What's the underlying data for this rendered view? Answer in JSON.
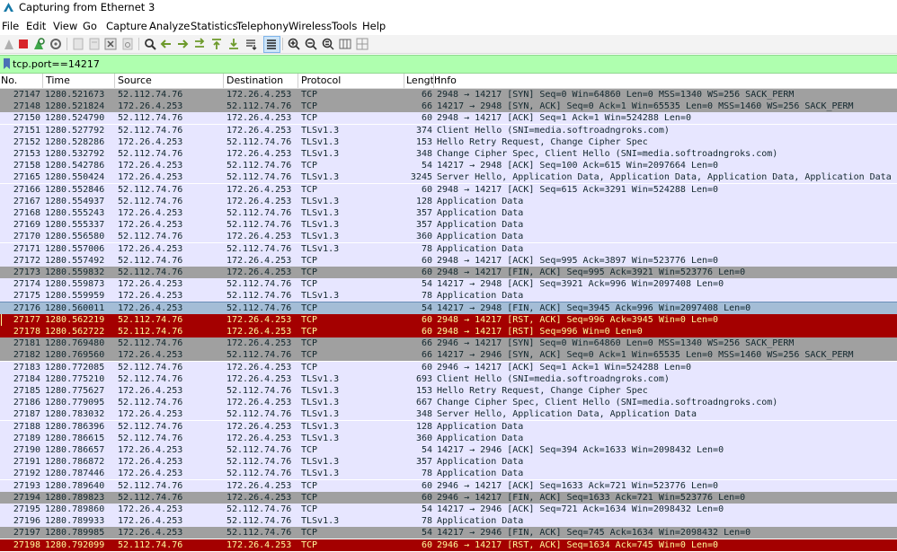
{
  "window": {
    "title": "Capturing from Ethernet 3"
  },
  "menu": [
    "File",
    "Edit",
    "View",
    "Go",
    "Capture",
    "Analyze",
    "Statistics",
    "Telephony",
    "Wireless",
    "Tools",
    "Help"
  ],
  "filter": {
    "value": "tcp.port==14217"
  },
  "columns": [
    "No.",
    "Time",
    "Source",
    "Destination",
    "Protocol",
    "Length",
    "Info"
  ],
  "colors": {
    "tcp_row": "#e7e6ff",
    "flag_row": "#a0a0a0",
    "selected_row": "#a4bdd6",
    "rst_row": "#a40000",
    "rst_text": "#fffc9c",
    "filter_ok": "#afffaf"
  },
  "toolbar_icons": [
    "shark-fin-start-icon",
    "stop-icon",
    "restart-icon",
    "options-gear-icon",
    "open-file-icon",
    "save-file-icon",
    "close-file-icon",
    "reload-icon",
    "find-icon",
    "back-arrow-icon",
    "forward-arrow-icon",
    "jump-icon",
    "first-packet-icon",
    "last-packet-icon",
    "autoscroll-icon",
    "colorize-icon",
    "zoom-in-icon",
    "zoom-out-icon",
    "normal-size-icon",
    "resize-columns-icon"
  ],
  "packets": [
    {
      "no": "27147",
      "time": "1280.521673",
      "src": "52.112.74.76",
      "dst": "172.26.4.253",
      "proto": "TCP",
      "len": "66",
      "info": "2948 → 14217 [SYN] Seq=0 Win=64860 Len=0 MSS=1340 WS=256 SACK_PERM",
      "style": "flag"
    },
    {
      "no": "27148",
      "time": "1280.521824",
      "src": "172.26.4.253",
      "dst": "52.112.74.76",
      "proto": "TCP",
      "len": "66",
      "info": "14217 → 2948 [SYN, ACK] Seq=0 Ack=1 Win=65535 Len=0 MSS=1460 WS=256 SACK_PERM",
      "style": "flag"
    },
    {
      "no": "27150",
      "time": "1280.524790",
      "src": "52.112.74.76",
      "dst": "172.26.4.253",
      "proto": "TCP",
      "len": "60",
      "info": "2948 → 14217 [ACK] Seq=1 Ack=1 Win=524288 Len=0",
      "style": "tcp"
    },
    {
      "no": "27151",
      "time": "1280.527792",
      "src": "52.112.74.76",
      "dst": "172.26.4.253",
      "proto": "TLSv1.3",
      "len": "374",
      "info": "Client Hello (SNI=media.softroadngroks.com)",
      "style": "tcp"
    },
    {
      "no": "27152",
      "time": "1280.528286",
      "src": "172.26.4.253",
      "dst": "52.112.74.76",
      "proto": "TLSv1.3",
      "len": "153",
      "info": "Hello Retry Request, Change Cipher Spec",
      "style": "tcp"
    },
    {
      "no": "27153",
      "time": "1280.532792",
      "src": "52.112.74.76",
      "dst": "172.26.4.253",
      "proto": "TLSv1.3",
      "len": "348",
      "info": "Change Cipher Spec, Client Hello (SNI=media.softroadngroks.com)",
      "style": "tcp"
    },
    {
      "no": "27158",
      "time": "1280.542786",
      "src": "172.26.4.253",
      "dst": "52.112.74.76",
      "proto": "TCP",
      "len": "54",
      "info": "14217 → 2948 [ACK] Seq=100 Ack=615 Win=2097664 Len=0",
      "style": "tcp"
    },
    {
      "no": "27165",
      "time": "1280.550424",
      "src": "172.26.4.253",
      "dst": "52.112.74.76",
      "proto": "TLSv1.3",
      "len": "3245",
      "info": "Server Hello, Application Data, Application Data, Application Data, Application Data",
      "style": "tcp"
    },
    {
      "no": "27166",
      "time": "1280.552846",
      "src": "52.112.74.76",
      "dst": "172.26.4.253",
      "proto": "TCP",
      "len": "60",
      "info": "2948 → 14217 [ACK] Seq=615 Ack=3291 Win=524288 Len=0",
      "style": "tcp"
    },
    {
      "no": "27167",
      "time": "1280.554937",
      "src": "52.112.74.76",
      "dst": "172.26.4.253",
      "proto": "TLSv1.3",
      "len": "128",
      "info": "Application Data",
      "style": "tcp"
    },
    {
      "no": "27168",
      "time": "1280.555243",
      "src": "172.26.4.253",
      "dst": "52.112.74.76",
      "proto": "TLSv1.3",
      "len": "357",
      "info": "Application Data",
      "style": "tcp"
    },
    {
      "no": "27169",
      "time": "1280.555337",
      "src": "172.26.4.253",
      "dst": "52.112.74.76",
      "proto": "TLSv1.3",
      "len": "357",
      "info": "Application Data",
      "style": "tcp"
    },
    {
      "no": "27170",
      "time": "1280.556580",
      "src": "52.112.74.76",
      "dst": "172.26.4.253",
      "proto": "TLSv1.3",
      "len": "360",
      "info": "Application Data",
      "style": "tcp"
    },
    {
      "no": "27171",
      "time": "1280.557006",
      "src": "172.26.4.253",
      "dst": "52.112.74.76",
      "proto": "TLSv1.3",
      "len": "78",
      "info": "Application Data",
      "style": "tcp"
    },
    {
      "no": "27172",
      "time": "1280.557492",
      "src": "52.112.74.76",
      "dst": "172.26.4.253",
      "proto": "TCP",
      "len": "60",
      "info": "2948 → 14217 [ACK] Seq=995 Ack=3897 Win=523776 Len=0",
      "style": "tcp"
    },
    {
      "no": "27173",
      "time": "1280.559832",
      "src": "52.112.74.76",
      "dst": "172.26.4.253",
      "proto": "TCP",
      "len": "60",
      "info": "2948 → 14217 [FIN, ACK] Seq=995 Ack=3921 Win=523776 Len=0",
      "style": "flag"
    },
    {
      "no": "27174",
      "time": "1280.559873",
      "src": "172.26.4.253",
      "dst": "52.112.74.76",
      "proto": "TCP",
      "len": "54",
      "info": "14217 → 2948 [ACK] Seq=3921 Ack=996 Win=2097408 Len=0",
      "style": "tcp"
    },
    {
      "no": "27175",
      "time": "1280.559959",
      "src": "172.26.4.253",
      "dst": "52.112.74.76",
      "proto": "TLSv1.3",
      "len": "78",
      "info": "Application Data",
      "style": "tcp"
    },
    {
      "no": "27176",
      "time": "1280.560011",
      "src": "172.26.4.253",
      "dst": "52.112.74.76",
      "proto": "TCP",
      "len": "54",
      "info": "14217 → 2948 [FIN, ACK] Seq=3945 Ack=996 Win=2097408 Len=0",
      "style": "selected"
    },
    {
      "no": "27177",
      "time": "1280.562219",
      "src": "52.112.74.76",
      "dst": "172.26.4.253",
      "proto": "TCP",
      "len": "60",
      "info": "2948 → 14217 [RST, ACK] Seq=996 Ack=3945 Win=0 Len=0",
      "style": "rst"
    },
    {
      "no": "27178",
      "time": "1280.562722",
      "src": "52.112.74.76",
      "dst": "172.26.4.253",
      "proto": "TCP",
      "len": "60",
      "info": "2948 → 14217 [RST] Seq=996 Win=0 Len=0",
      "style": "rst"
    },
    {
      "no": "27181",
      "time": "1280.769480",
      "src": "52.112.74.76",
      "dst": "172.26.4.253",
      "proto": "TCP",
      "len": "66",
      "info": "2946 → 14217 [SYN] Seq=0 Win=64860 Len=0 MSS=1340 WS=256 SACK_PERM",
      "style": "flag"
    },
    {
      "no": "27182",
      "time": "1280.769560",
      "src": "172.26.4.253",
      "dst": "52.112.74.76",
      "proto": "TCP",
      "len": "66",
      "info": "14217 → 2946 [SYN, ACK] Seq=0 Ack=1 Win=65535 Len=0 MSS=1460 WS=256 SACK_PERM",
      "style": "flag"
    },
    {
      "no": "27183",
      "time": "1280.772085",
      "src": "52.112.74.76",
      "dst": "172.26.4.253",
      "proto": "TCP",
      "len": "60",
      "info": "2946 → 14217 [ACK] Seq=1 Ack=1 Win=524288 Len=0",
      "style": "tcp"
    },
    {
      "no": "27184",
      "time": "1280.775210",
      "src": "52.112.74.76",
      "dst": "172.26.4.253",
      "proto": "TLSv1.3",
      "len": "693",
      "info": "Client Hello (SNI=media.softroadngroks.com)",
      "style": "tcp"
    },
    {
      "no": "27185",
      "time": "1280.775627",
      "src": "172.26.4.253",
      "dst": "52.112.74.76",
      "proto": "TLSv1.3",
      "len": "153",
      "info": "Hello Retry Request, Change Cipher Spec",
      "style": "tcp"
    },
    {
      "no": "27186",
      "time": "1280.779095",
      "src": "52.112.74.76",
      "dst": "172.26.4.253",
      "proto": "TLSv1.3",
      "len": "667",
      "info": "Change Cipher Spec, Client Hello (SNI=media.softroadngroks.com)",
      "style": "tcp"
    },
    {
      "no": "27187",
      "time": "1280.783032",
      "src": "172.26.4.253",
      "dst": "52.112.74.76",
      "proto": "TLSv1.3",
      "len": "348",
      "info": "Server Hello, Application Data, Application Data",
      "style": "tcp"
    },
    {
      "no": "27188",
      "time": "1280.786396",
      "src": "52.112.74.76",
      "dst": "172.26.4.253",
      "proto": "TLSv1.3",
      "len": "128",
      "info": "Application Data",
      "style": "tcp"
    },
    {
      "no": "27189",
      "time": "1280.786615",
      "src": "52.112.74.76",
      "dst": "172.26.4.253",
      "proto": "TLSv1.3",
      "len": "360",
      "info": "Application Data",
      "style": "tcp"
    },
    {
      "no": "27190",
      "time": "1280.786657",
      "src": "172.26.4.253",
      "dst": "52.112.74.76",
      "proto": "TCP",
      "len": "54",
      "info": "14217 → 2946 [ACK] Seq=394 Ack=1633 Win=2098432 Len=0",
      "style": "tcp"
    },
    {
      "no": "27191",
      "time": "1280.786872",
      "src": "172.26.4.253",
      "dst": "52.112.74.76",
      "proto": "TLSv1.3",
      "len": "357",
      "info": "Application Data",
      "style": "tcp"
    },
    {
      "no": "27192",
      "time": "1280.787446",
      "src": "172.26.4.253",
      "dst": "52.112.74.76",
      "proto": "TLSv1.3",
      "len": "78",
      "info": "Application Data",
      "style": "tcp"
    },
    {
      "no": "27193",
      "time": "1280.789640",
      "src": "52.112.74.76",
      "dst": "172.26.4.253",
      "proto": "TCP",
      "len": "60",
      "info": "2946 → 14217 [ACK] Seq=1633 Ack=721 Win=523776 Len=0",
      "style": "tcp"
    },
    {
      "no": "27194",
      "time": "1280.789823",
      "src": "52.112.74.76",
      "dst": "172.26.4.253",
      "proto": "TCP",
      "len": "60",
      "info": "2946 → 14217 [FIN, ACK] Seq=1633 Ack=721 Win=523776 Len=0",
      "style": "flag"
    },
    {
      "no": "27195",
      "time": "1280.789860",
      "src": "172.26.4.253",
      "dst": "52.112.74.76",
      "proto": "TCP",
      "len": "54",
      "info": "14217 → 2946 [ACK] Seq=721 Ack=1634 Win=2098432 Len=0",
      "style": "tcp"
    },
    {
      "no": "27196",
      "time": "1280.789933",
      "src": "172.26.4.253",
      "dst": "52.112.74.76",
      "proto": "TLSv1.3",
      "len": "78",
      "info": "Application Data",
      "style": "tcp"
    },
    {
      "no": "27197",
      "time": "1280.789985",
      "src": "172.26.4.253",
      "dst": "52.112.74.76",
      "proto": "TCP",
      "len": "54",
      "info": "14217 → 2946 [FIN, ACK] Seq=745 Ack=1634 Win=2098432 Len=0",
      "style": "flag"
    },
    {
      "no": "27198",
      "time": "1280.792099",
      "src": "52.112.74.76",
      "dst": "172.26.4.253",
      "proto": "TCP",
      "len": "60",
      "info": "2946 → 14217 [RST, ACK] Seq=1634 Ack=745 Win=0 Len=0",
      "style": "rst"
    }
  ]
}
